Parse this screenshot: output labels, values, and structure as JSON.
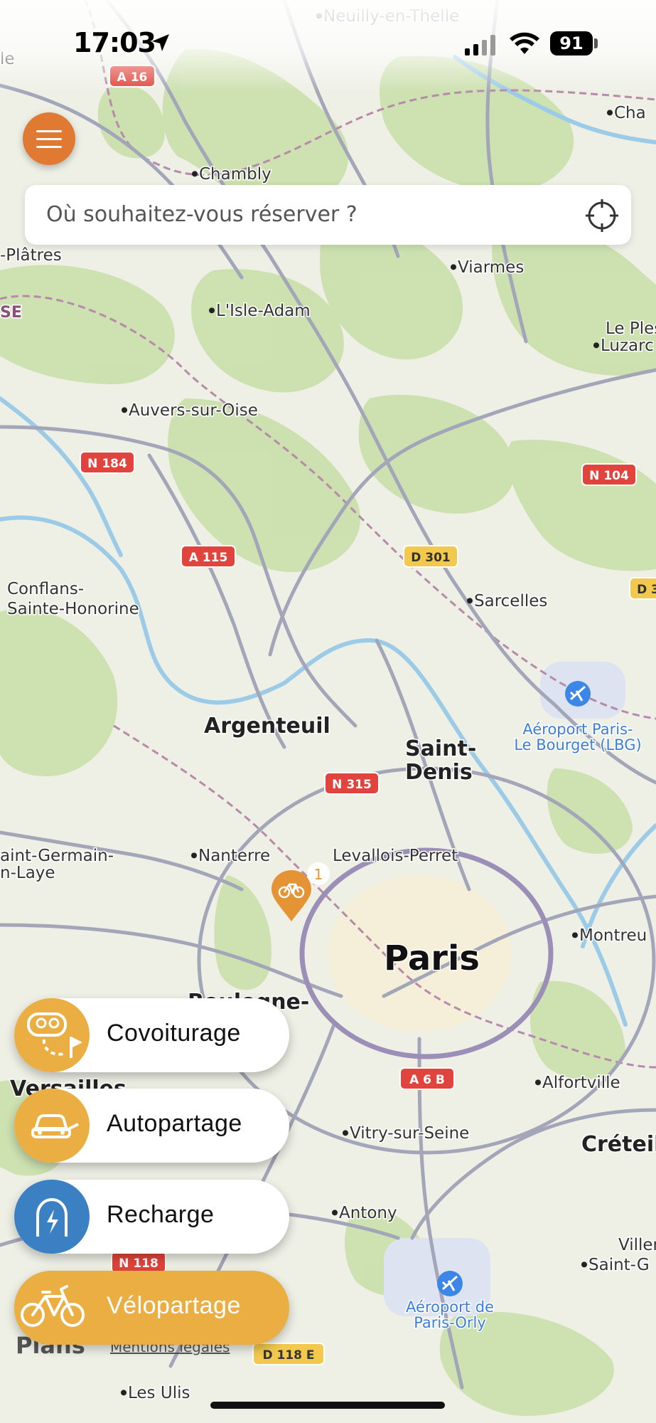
{
  "status_bar": {
    "time": "17:03",
    "battery": "91",
    "icons": [
      "location-arrow-icon",
      "cellular-signal-icon",
      "wifi-icon",
      "battery-icon"
    ]
  },
  "colors": {
    "accent": "#e07a33",
    "mode_yellow": "#ebae42",
    "mode_blue": "#3a80c3",
    "map_land": "#eef0e6",
    "map_forest": "#c8deaa",
    "map_water": "#9ccbe8",
    "road": "#a3a6b8",
    "shield_red": "#e0443c",
    "shield_yellow": "#f2c94c"
  },
  "menu": {
    "icon": "hamburger-menu-icon"
  },
  "search": {
    "placeholder": "Où souhaitez-vous réserver ?",
    "icon": "crosshair-location-icon"
  },
  "map": {
    "places": [
      {
        "name": "Neuilly-en-Thelle",
        "size": "small"
      },
      {
        "name": "Chambly",
        "size": "small"
      },
      {
        "name": "Viarmes",
        "size": "small"
      },
      {
        "name": "L'Isle-Adam",
        "size": "small"
      },
      {
        "name": "Auvers-sur-Oise",
        "size": "small"
      },
      {
        "name": "Conflans-",
        "size": "small"
      },
      {
        "name": "Sainte-Honorine",
        "size": "small"
      },
      {
        "name": "Sarcelles",
        "size": "small"
      },
      {
        "name": "Argenteuil",
        "size": "medium"
      },
      {
        "name": "Saint-",
        "size": "medium"
      },
      {
        "name": "Denis",
        "size": "medium"
      },
      {
        "name": "Nanterre",
        "size": "small"
      },
      {
        "name": "Levallois-Perret",
        "size": "small"
      },
      {
        "name": "Paris",
        "size": "large"
      },
      {
        "name": "Boulogne-",
        "size": "medium"
      },
      {
        "name": "rt",
        "size": "medium"
      },
      {
        "name": "Versailles",
        "size": "medium"
      },
      {
        "name": "Alfortville",
        "size": "small"
      },
      {
        "name": "Vitry-sur-Seine",
        "size": "small"
      },
      {
        "name": "Créteil",
        "size": "medium"
      },
      {
        "name": "Antony",
        "size": "small"
      },
      {
        "name": "Les Ulis",
        "size": "small"
      },
      {
        "name": "Montreu",
        "size": "small"
      },
      {
        "name": "Villeneu",
        "size": "small"
      },
      {
        "name": "Saint-G",
        "size": "small"
      },
      {
        "name": "aint-Germain-",
        "size": "small"
      },
      {
        "name": "n-Laye",
        "size": "small"
      },
      {
        "name": "Le Ples",
        "size": "small"
      },
      {
        "name": "Luzarc",
        "size": "small"
      },
      {
        "name": "Cha",
        "size": "small"
      },
      {
        "name": "le",
        "size": "small"
      },
      {
        "name": "-Plâtres",
        "size": "small"
      },
      {
        "name": "SE",
        "size": "region"
      }
    ],
    "airports": [
      {
        "line1": "Aéroport Paris-",
        "line2": "Le Bourget (LBG)"
      },
      {
        "line1": "Aéroport de",
        "line2": "Paris-Orly"
      }
    ],
    "road_shields": [
      {
        "label": "A 16",
        "type": "red"
      },
      {
        "label": "N 184",
        "type": "red"
      },
      {
        "label": "A 115",
        "type": "red"
      },
      {
        "label": "N 104",
        "type": "red"
      },
      {
        "label": "D 301",
        "type": "yellow"
      },
      {
        "label": "D 3",
        "type": "yellow"
      },
      {
        "label": "N 315",
        "type": "red"
      },
      {
        "label": "A 6 B",
        "type": "red"
      },
      {
        "label": "N 118",
        "type": "red"
      },
      {
        "label": "D 118 E",
        "type": "yellow"
      }
    ],
    "station_marker": {
      "count": "1",
      "icon": "bicycle-icon"
    },
    "attribution": {
      "brand": "Plans",
      "legal": "Mentions légales"
    }
  },
  "modes": [
    {
      "label": "Covoiturage",
      "icon": "carpool-icon",
      "active": false
    },
    {
      "label": "Autopartage",
      "icon": "car-plug-icon",
      "active": false
    },
    {
      "label": "Recharge",
      "icon": "charging-bolt-icon",
      "active": false
    },
    {
      "label": "Vélopartage",
      "icon": "bicycle-icon",
      "active": true
    }
  ]
}
